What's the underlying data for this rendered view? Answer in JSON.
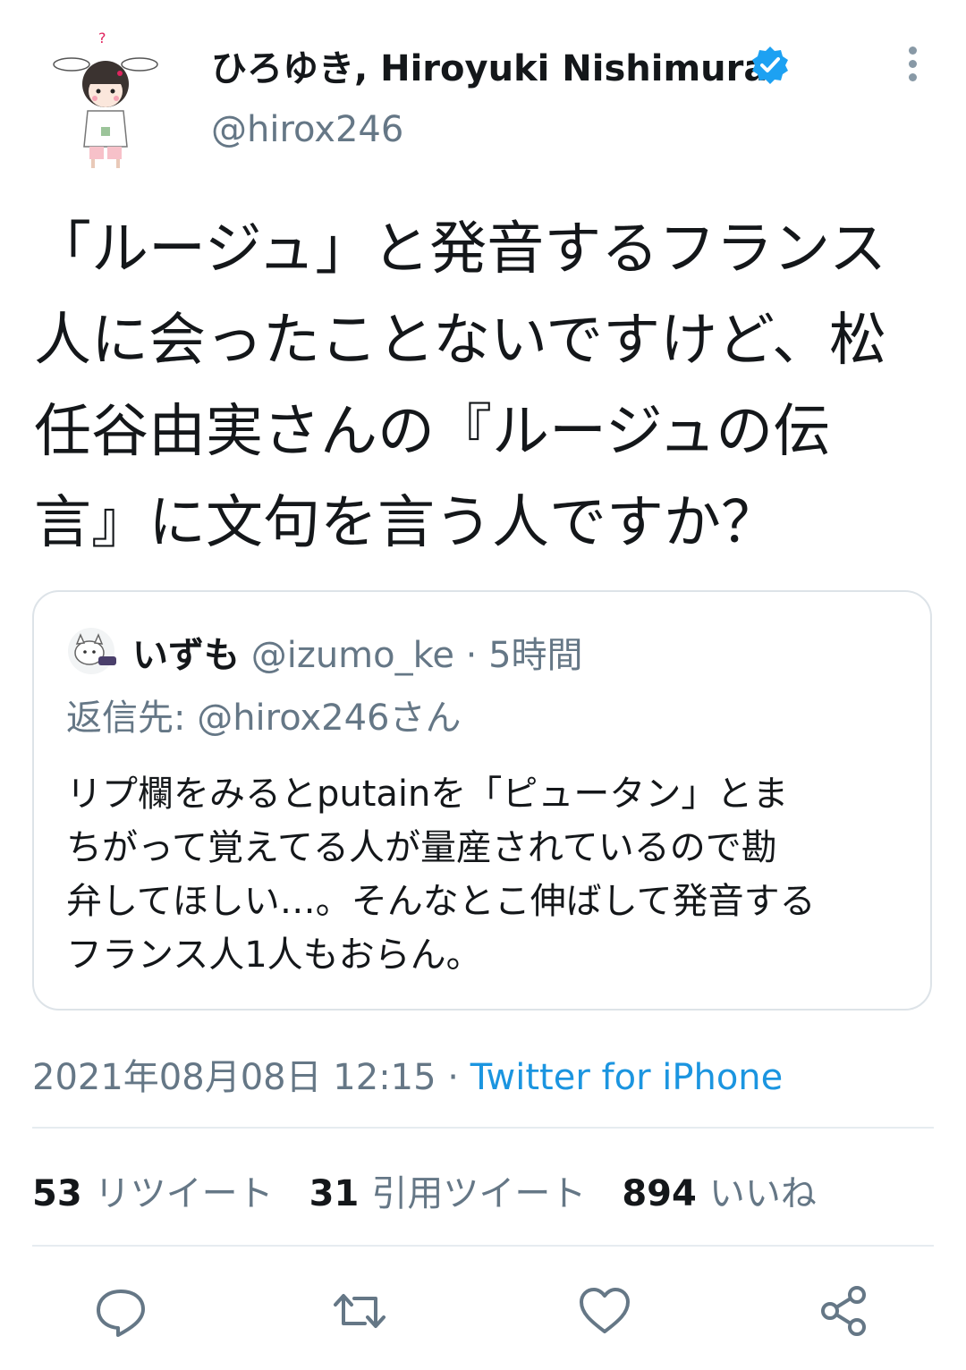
{
  "author": {
    "display_name": "ひろゆき, Hiroyuki Nishimura",
    "handle": "@hirox246",
    "verified": true
  },
  "tweet": {
    "lines": [
      "「ルージュ」と発音するフランス",
      "人に会ったことないですけど、松",
      "任谷由実さんの『ルージュの伝",
      "言』に文句を言う人ですか？"
    ]
  },
  "quoted_tweet": {
    "name": "いずも",
    "meta": "@izumo_ke · 5時間",
    "reply_to": "返信先: @hirox246さん",
    "lines": [
      "リプ欄をみるとputainを「ピュータン」とま",
      "ちがって覚えてる人が量産されているので勘",
      "弁してほしい…。そんなとこ伸ばして発音する",
      "フランス人1人もおらん。"
    ]
  },
  "timestamp": {
    "date": "2021年08月08日 12:15 · ",
    "client": "Twitter for iPhone"
  },
  "stats": {
    "retweets": {
      "count": "53",
      "label": "リツイート"
    },
    "quotes": {
      "count": "31",
      "label": "引用ツイート"
    },
    "likes": {
      "count": "894",
      "label": "いいね"
    }
  },
  "actions": {
    "reply_icon": "reply-icon",
    "retweet_icon": "retweet-icon",
    "like_icon": "heart-icon",
    "share_icon": "share-icon"
  },
  "colors": {
    "verified_blue": "#1da1f2",
    "link_blue": "#1b95e0",
    "secondary_text": "#657786",
    "icon_gray": "#657786"
  }
}
